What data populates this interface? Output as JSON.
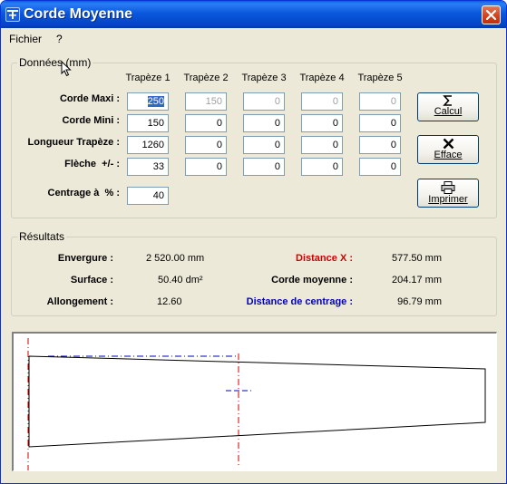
{
  "window": {
    "title": "Corde Moyenne"
  },
  "menu": {
    "items": [
      "Fichier",
      "?"
    ]
  },
  "donnees": {
    "title": "Données (mm)",
    "columns": [
      "Trapèze 1",
      "Trapèze 2",
      "Trapèze 3",
      "Trapèze 4",
      "Trapèze 5"
    ],
    "rows": [
      {
        "label": "Corde Maxi :",
        "values": [
          "250",
          "150",
          "0",
          "0",
          "0"
        ],
        "disabled": [
          false,
          true,
          true,
          true,
          true
        ]
      },
      {
        "label": "Corde Mini :",
        "values": [
          "150",
          "0",
          "0",
          "0",
          "0"
        ],
        "disabled": [
          false,
          false,
          false,
          false,
          false
        ]
      },
      {
        "label": "Longueur Trapèze :",
        "values": [
          "1260",
          "0",
          "0",
          "0",
          "0"
        ],
        "disabled": [
          false,
          false,
          false,
          false,
          false
        ]
      },
      {
        "label": "Flèche  +/- :",
        "values": [
          "33",
          "0",
          "0",
          "0",
          "0"
        ],
        "disabled": [
          false,
          false,
          false,
          false,
          false
        ]
      }
    ],
    "centrage": {
      "label": "Centrage à  % :",
      "value": "40"
    }
  },
  "buttons": {
    "calcul": "Calcul",
    "efface": "Efface",
    "imprimer": "Imprimer"
  },
  "resultats": {
    "title": "Résultats",
    "envergure": {
      "label": "Envergure :",
      "value": "2 520.00 mm"
    },
    "surface": {
      "label": "Surface :",
      "value": "50.40 dm²"
    },
    "allongement": {
      "label": "Allongement :",
      "value": "12.60"
    },
    "distance_x": {
      "label": "Distance X :",
      "value": "577.50 mm"
    },
    "corde_moyenne": {
      "label": "Corde moyenne :",
      "value": "204.17 mm"
    },
    "distance_centrage": {
      "label": "Distance de centrage :",
      "value": "96.79 mm"
    }
  },
  "colors": {
    "accent_blue": "#0000c0",
    "accent_red": "#d00000",
    "selection": "#316ac5"
  }
}
